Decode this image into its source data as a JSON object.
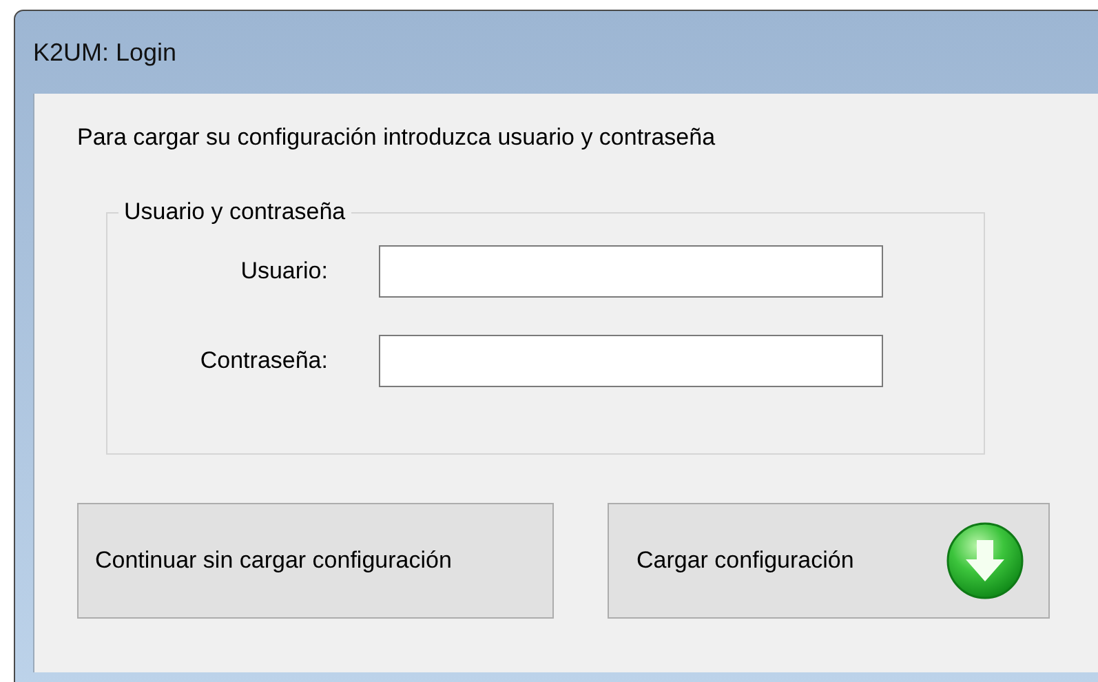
{
  "window": {
    "title": "K2UM: Login"
  },
  "intro": "Para cargar su configuración introduzca usuario y contraseña",
  "group": {
    "legend": "Usuario y contraseña",
    "fields": [
      {
        "label": "Usuario:"
      },
      {
        "label": "Contraseña:"
      }
    ]
  },
  "buttons": [
    {
      "label": "Continuar sin cargar configuración",
      "kind": "plain"
    },
    {
      "label": "Cargar configuración",
      "kind": "download"
    }
  ]
}
